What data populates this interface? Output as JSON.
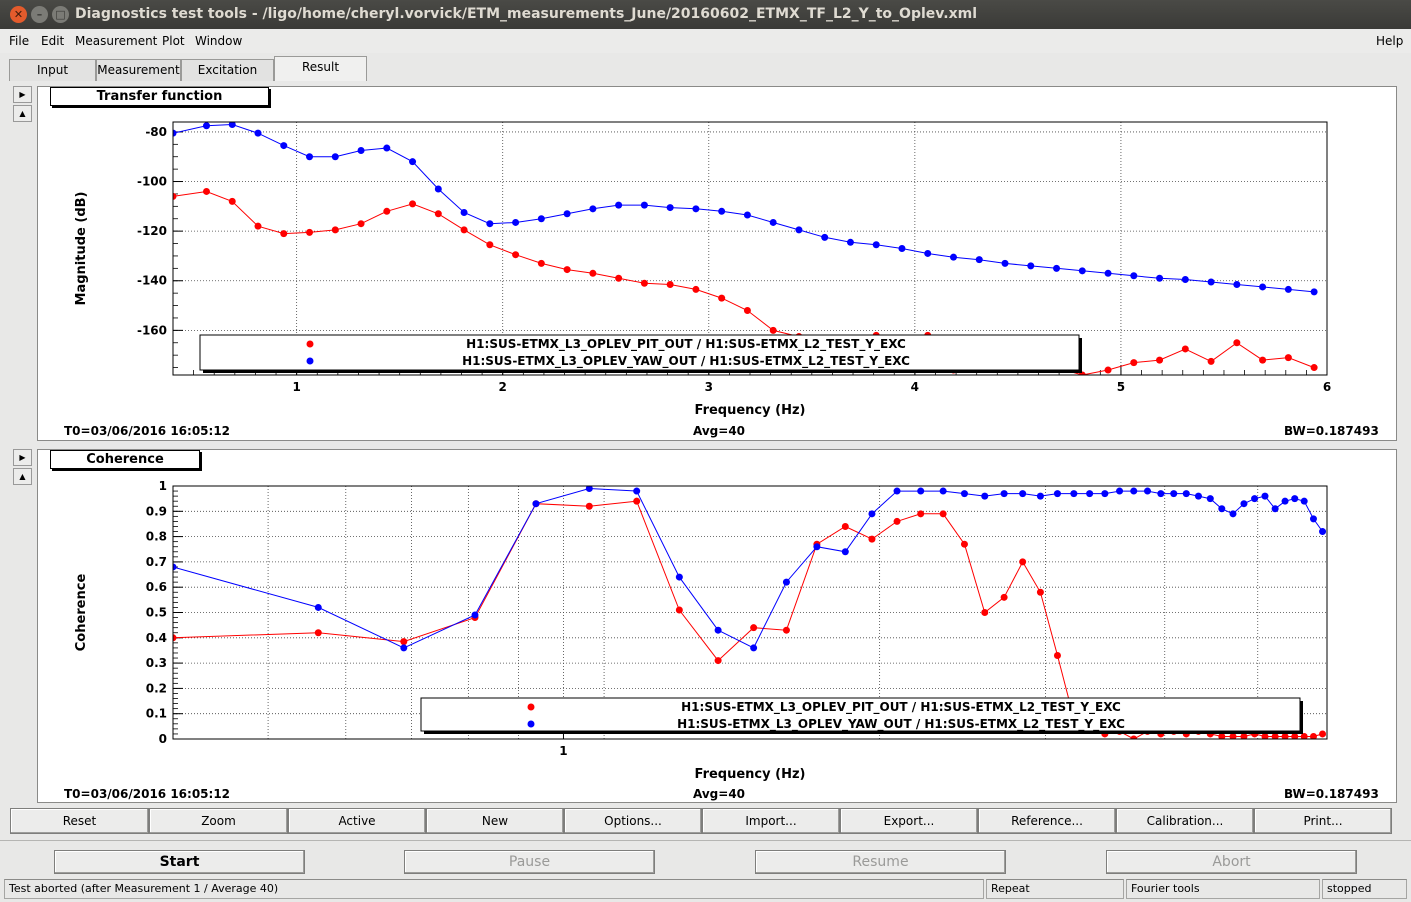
{
  "window": {
    "title": "Diagnostics test tools - /ligo/home/cheryl.vorvick/ETM_measurements_June/20160602_ETMX_TF_L2_Y_to_Oplev.xml"
  },
  "menu": {
    "file": "File",
    "edit": "Edit",
    "measurement": "Measurement",
    "plot": "Plot",
    "window": "Window",
    "help": "Help"
  },
  "tabs": [
    "Input",
    "Measurement",
    "Excitation",
    "Result"
  ],
  "active_tab": "Result",
  "colors": {
    "series1": "#ff0000",
    "series2": "#0000ff"
  },
  "panels": {
    "transfer": {
      "title": "Transfer function",
      "t0": "T0=03/06/2016 16:05:12",
      "avg": "Avg=40",
      "bw": "BW=0.187493"
    },
    "coherence": {
      "title": "Coherence",
      "t0": "T0=03/06/2016 16:05:12",
      "avg": "Avg=40",
      "bw": "BW=0.187493"
    }
  },
  "chart_data": [
    {
      "type": "line",
      "title": "Transfer function",
      "xlabel": "Frequency (Hz)",
      "ylabel": "Magnitude (dB)",
      "xlim": [
        0.4,
        6.0
      ],
      "ylim": [
        -178,
        -76
      ],
      "x_ticks": [
        1,
        2,
        3,
        4,
        5,
        6
      ],
      "y_ticks": [
        -80,
        -100,
        -120,
        -140,
        -160
      ],
      "grid": true,
      "legend_position": "bottom",
      "series": [
        {
          "name": "H1:SUS-ETMX_L3_OPLEV_PIT_OUT / H1:SUS-ETMX_L2_TEST_Y_EXC",
          "color": "#ff0000",
          "x": [
            0.4,
            0.5625,
            0.6875,
            0.8125,
            0.9375,
            1.0625,
            1.1875,
            1.3125,
            1.4375,
            1.5625,
            1.6875,
            1.8125,
            1.9375,
            2.0625,
            2.1875,
            2.3125,
            2.4375,
            2.5625,
            2.6875,
            2.8125,
            2.9375,
            3.0625,
            3.1875,
            3.3125,
            3.4375,
            3.5625,
            3.6875,
            3.8125,
            3.9375,
            4.0625,
            4.1875,
            4.3125,
            4.4375,
            4.5625,
            4.6875,
            4.8125,
            4.9375,
            5.0625,
            5.1875,
            5.3125,
            5.4375,
            5.5625,
            5.6875,
            5.8125,
            5.9375
          ],
          "y": [
            -106,
            -104,
            -108,
            -118,
            -121,
            -120.5,
            -119.5,
            -117,
            -112,
            -109,
            -113,
            -119.5,
            -125.5,
            -129.5,
            -133,
            -135.5,
            -137,
            -139,
            -141,
            -141.5,
            -143.5,
            -147,
            -152,
            -160,
            -162.5,
            -174,
            -167,
            -162,
            -166,
            -162,
            -176,
            -172,
            -173,
            -174,
            -175,
            -178,
            -176,
            -173,
            -172,
            -167.5,
            -172.5,
            -165,
            -172,
            -171,
            -175
          ]
        },
        {
          "name": "H1:SUS-ETMX_L3_OPLEV_YAW_OUT / H1:SUS-ETMX_L2_TEST_Y_EXC",
          "color": "#0000ff",
          "x": [
            0.4,
            0.5625,
            0.6875,
            0.8125,
            0.9375,
            1.0625,
            1.1875,
            1.3125,
            1.4375,
            1.5625,
            1.6875,
            1.8125,
            1.9375,
            2.0625,
            2.1875,
            2.3125,
            2.4375,
            2.5625,
            2.6875,
            2.8125,
            2.9375,
            3.0625,
            3.1875,
            3.3125,
            3.4375,
            3.5625,
            3.6875,
            3.8125,
            3.9375,
            4.0625,
            4.1875,
            4.3125,
            4.4375,
            4.5625,
            4.6875,
            4.8125,
            4.9375,
            5.0625,
            5.1875,
            5.3125,
            5.4375,
            5.5625,
            5.6875,
            5.8125,
            5.9375
          ],
          "y": [
            -80.5,
            -77.5,
            -77,
            -80.5,
            -85.5,
            -90,
            -90,
            -87.5,
            -86.5,
            -92,
            -103,
            -112.5,
            -117,
            -116.5,
            -115,
            -113,
            -111,
            -109.5,
            -109.5,
            -110.5,
            -111,
            -112,
            -113.5,
            -116.5,
            -119.5,
            -122.5,
            -124.5,
            -125.5,
            -127,
            -129,
            -130.5,
            -131.5,
            -133,
            -134,
            -135,
            -136,
            -137,
            -138,
            -139,
            -139.5,
            -140.5,
            -141.5,
            -142.5,
            -143.5,
            -144.5
          ]
        }
      ]
    },
    {
      "type": "line",
      "title": "Coherence",
      "xlabel": "Frequency (Hz)",
      "ylabel": "Coherence",
      "xlim": [
        0.4,
        6.0
      ],
      "ylim": [
        0,
        1
      ],
      "x_scale": "log",
      "x_ticks": [
        1
      ],
      "y_ticks": [
        0,
        0.1,
        0.2,
        0.3,
        0.4,
        0.5,
        0.6,
        0.7,
        0.8,
        0.9,
        1
      ],
      "grid": true,
      "legend_position": "bottom",
      "series": [
        {
          "name": "H1:SUS-ETMX_L3_OPLEV_PIT_OUT / H1:SUS-ETMX_L2_TEST_Y_EXC",
          "color": "#ff0000",
          "x": [
            0.4,
            0.5625,
            0.6875,
            0.8125,
            0.9375,
            1.0625,
            1.1875,
            1.3125,
            1.4375,
            1.5625,
            1.6875,
            1.8125,
            1.9375,
            2.0625,
            2.1875,
            2.3125,
            2.4375,
            2.5625,
            2.6875,
            2.8125,
            2.9375,
            3.0625,
            3.1875,
            3.3125,
            3.4375,
            3.5625,
            3.6875,
            3.8125,
            3.9375,
            4.0625,
            4.1875,
            4.3125,
            4.4375,
            4.5625,
            4.6875,
            4.8125,
            4.9375,
            5.0625,
            5.1875,
            5.3125,
            5.4375,
            5.5625,
            5.6875,
            5.8125,
            5.9375
          ],
          "y": [
            0.4,
            0.42,
            0.385,
            0.48,
            0.93,
            0.92,
            0.94,
            0.51,
            0.31,
            0.44,
            0.43,
            0.77,
            0.84,
            0.79,
            0.86,
            0.89,
            0.89,
            0.77,
            0.5,
            0.56,
            0.7,
            0.58,
            0.33,
            0.08,
            0.05,
            0.02,
            0.03,
            0.0,
            0.03,
            0.02,
            0.03,
            0.02,
            0.03,
            0.02,
            0.01,
            0.01,
            0.01,
            0.02,
            0.01,
            0.01,
            0.01,
            0.01,
            0.01,
            0.01,
            0.02
          ]
        },
        {
          "name": "H1:SUS-ETMX_L3_OPLEV_YAW_OUT / H1:SUS-ETMX_L2_TEST_Y_EXC",
          "color": "#0000ff",
          "x": [
            0.4,
            0.5625,
            0.6875,
            0.8125,
            0.9375,
            1.0625,
            1.1875,
            1.3125,
            1.4375,
            1.5625,
            1.6875,
            1.8125,
            1.9375,
            2.0625,
            2.1875,
            2.3125,
            2.4375,
            2.5625,
            2.6875,
            2.8125,
            2.9375,
            3.0625,
            3.1875,
            3.3125,
            3.4375,
            3.5625,
            3.6875,
            3.8125,
            3.9375,
            4.0625,
            4.1875,
            4.3125,
            4.4375,
            4.5625,
            4.6875,
            4.8125,
            4.9375,
            5.0625,
            5.1875,
            5.3125,
            5.4375,
            5.5625,
            5.6875,
            5.8125,
            5.9375
          ],
          "y": [
            0.68,
            0.52,
            0.36,
            0.49,
            0.93,
            0.99,
            0.98,
            0.64,
            0.43,
            0.36,
            0.62,
            0.76,
            0.74,
            0.89,
            0.98,
            0.98,
            0.98,
            0.97,
            0.96,
            0.97,
            0.97,
            0.96,
            0.97,
            0.97,
            0.97,
            0.97,
            0.98,
            0.98,
            0.98,
            0.97,
            0.97,
            0.97,
            0.96,
            0.95,
            0.91,
            0.89,
            0.93,
            0.95,
            0.96,
            0.91,
            0.94,
            0.95,
            0.94,
            0.87,
            0.82
          ]
        }
      ]
    }
  ],
  "toolbar": {
    "reset": "Reset",
    "zoom": "Zoom",
    "active": "Active",
    "new": "New",
    "options": "Options...",
    "import": "Import...",
    "export": "Export...",
    "reference": "Reference...",
    "calibration": "Calibration...",
    "print": "Print..."
  },
  "controls": {
    "start": "Start",
    "pause": "Pause",
    "resume": "Resume",
    "abort": "Abort"
  },
  "status": {
    "message": "Test aborted (after Measurement 1 / Average 40)",
    "mode": "Repeat",
    "tool": "Fourier tools",
    "state": "stopped"
  }
}
